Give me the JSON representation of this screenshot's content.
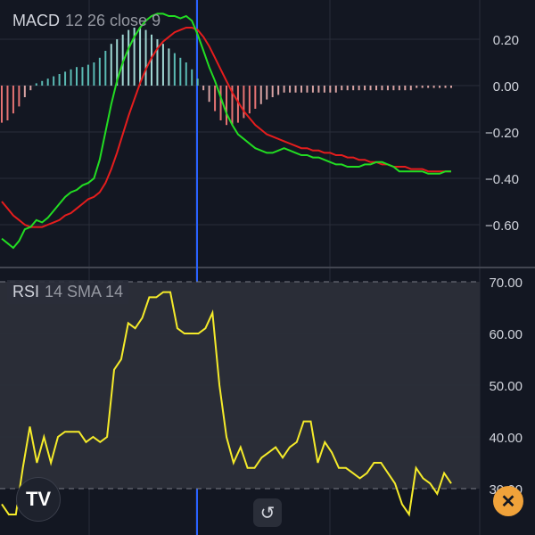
{
  "colors": {
    "background": "#131722",
    "grid": "#2a2e39",
    "macd_line": "#22dd22",
    "signal_line": "#e51d1d",
    "hist_pos": "#5bbab4",
    "hist_pos_strong": "#a0d6d2",
    "hist_neg": "#e57373",
    "hist_neg_weak": "#d8a3a3",
    "rsi_line": "#f5eb2a",
    "rsi_band": "#2a2d37",
    "crosshair": "#2962ff",
    "axis_text": "#d1d4dc"
  },
  "macd_panel": {
    "name": "MACD",
    "params": "12 26 close 9"
  },
  "rsi_panel": {
    "name": "RSI",
    "params": "14 SMA 14"
  },
  "buttons": {
    "logo_text": "TV",
    "logo_icon": "tradingview-logo",
    "reset_symbol": "↺",
    "reset_icon": "reset-chart-icon",
    "close_symbol": "✕",
    "close_icon": "close-icon"
  },
  "chart_data": [
    {
      "type": "line",
      "title": "MACD 12 26 close 9",
      "ylim": [
        -0.78,
        0.34
      ],
      "yticks": [
        "0.20",
        "0.00",
        "−0.20",
        "−0.40",
        "−0.60"
      ],
      "ytick_values": [
        0.2,
        0.0,
        -0.2,
        -0.4,
        -0.6
      ],
      "x": [
        0,
        1,
        2,
        3,
        4,
        5,
        6,
        7,
        8,
        9,
        10,
        11,
        12,
        13,
        14,
        15,
        16,
        17,
        18,
        19,
        20,
        21,
        22,
        23,
        24,
        25,
        26,
        27,
        28,
        29,
        30,
        31,
        32,
        33,
        34,
        35,
        36,
        37,
        38,
        39,
        40,
        41,
        42,
        43,
        44,
        45,
        46,
        47,
        48,
        49,
        50,
        51,
        52,
        53,
        54,
        55,
        56,
        57,
        58,
        59,
        60,
        61,
        62,
        63,
        64,
        65,
        66,
        67,
        68,
        69,
        70,
        71,
        72,
        73,
        74,
        75,
        76,
        77,
        78,
        79,
        80,
        81,
        82,
        83,
        84
      ],
      "series": [
        {
          "name": "MACD",
          "values": [
            -0.66,
            -0.68,
            -0.7,
            -0.67,
            -0.62,
            -0.61,
            -0.58,
            -0.59,
            -0.57,
            -0.54,
            -0.51,
            -0.48,
            -0.46,
            -0.45,
            -0.43,
            -0.42,
            -0.4,
            -0.32,
            -0.2,
            -0.08,
            0.02,
            0.1,
            0.16,
            0.21,
            0.25,
            0.28,
            0.3,
            0.31,
            0.31,
            0.3,
            0.3,
            0.29,
            0.3,
            0.28,
            0.22,
            0.15,
            0.08,
            0.02,
            -0.05,
            -0.12,
            -0.17,
            -0.21,
            -0.23,
            -0.25,
            -0.27,
            -0.28,
            -0.29,
            -0.29,
            -0.28,
            -0.27,
            -0.28,
            -0.29,
            -0.3,
            -0.3,
            -0.31,
            -0.31,
            -0.32,
            -0.33,
            -0.34,
            -0.34,
            -0.35,
            -0.35,
            -0.35,
            -0.34,
            -0.34,
            -0.33,
            -0.33,
            -0.34,
            -0.35,
            -0.37,
            -0.37,
            -0.37,
            -0.37,
            -0.37,
            -0.38,
            -0.38,
            -0.38,
            -0.37,
            -0.37
          ]
        },
        {
          "name": "Signal",
          "values": [
            -0.5,
            -0.53,
            -0.56,
            -0.58,
            -0.6,
            -0.61,
            -0.61,
            -0.61,
            -0.6,
            -0.59,
            -0.58,
            -0.56,
            -0.55,
            -0.53,
            -0.51,
            -0.49,
            -0.48,
            -0.46,
            -0.42,
            -0.36,
            -0.29,
            -0.21,
            -0.13,
            -0.06,
            0.01,
            0.07,
            0.12,
            0.16,
            0.19,
            0.21,
            0.23,
            0.24,
            0.25,
            0.25,
            0.24,
            0.21,
            0.17,
            0.12,
            0.07,
            0.02,
            -0.03,
            -0.07,
            -0.11,
            -0.14,
            -0.17,
            -0.19,
            -0.21,
            -0.22,
            -0.23,
            -0.24,
            -0.25,
            -0.26,
            -0.27,
            -0.27,
            -0.28,
            -0.28,
            -0.29,
            -0.29,
            -0.3,
            -0.3,
            -0.31,
            -0.31,
            -0.32,
            -0.32,
            -0.33,
            -0.33,
            -0.34,
            -0.34,
            -0.35,
            -0.35,
            -0.35,
            -0.36,
            -0.36,
            -0.36,
            -0.37,
            -0.37,
            -0.37,
            -0.37,
            -0.37
          ]
        }
      ],
      "histogram": {
        "name": "Histogram",
        "values": [
          -0.16,
          -0.15,
          -0.12,
          -0.09,
          -0.05,
          -0.02,
          0.01,
          0.02,
          0.03,
          0.04,
          0.05,
          0.06,
          0.07,
          0.08,
          0.08,
          0.09,
          0.1,
          0.12,
          0.15,
          0.18,
          0.2,
          0.22,
          0.24,
          0.25,
          0.25,
          0.24,
          0.22,
          0.2,
          0.18,
          0.16,
          0.14,
          0.12,
          0.1,
          0.07,
          0.03,
          -0.02,
          -0.07,
          -0.11,
          -0.15,
          -0.17,
          -0.17,
          -0.16,
          -0.14,
          -0.12,
          -0.1,
          -0.08,
          -0.06,
          -0.05,
          -0.04,
          -0.03,
          -0.03,
          -0.03,
          -0.03,
          -0.03,
          -0.03,
          -0.03,
          -0.03,
          -0.03,
          -0.03,
          -0.02,
          -0.02,
          -0.02,
          -0.02,
          -0.02,
          -0.02,
          -0.02,
          -0.02,
          -0.02,
          -0.02,
          -0.02,
          -0.02,
          -0.02,
          -0.01,
          -0.01,
          -0.01,
          -0.01,
          -0.01,
          -0.01,
          -0.01
        ]
      }
    },
    {
      "type": "line",
      "title": "RSI 14 SMA 14",
      "ylim": [
        26,
        70
      ],
      "yticks": [
        "70.00",
        "60.00",
        "50.00",
        "40.00",
        "30.00"
      ],
      "ytick_values": [
        70,
        60,
        50,
        40,
        30
      ],
      "band": [
        30,
        70
      ],
      "series": [
        {
          "name": "RSI",
          "values": [
            27,
            25,
            25,
            34,
            42,
            35,
            40,
            35,
            40,
            41,
            41,
            41,
            39,
            40,
            39,
            40,
            53,
            55,
            62,
            61,
            63,
            67,
            67,
            68,
            68,
            61,
            60,
            60,
            60,
            61,
            64,
            50,
            40,
            35,
            38,
            34,
            34,
            36,
            37,
            38,
            36,
            38,
            39,
            43,
            43,
            35,
            39,
            37,
            34,
            34,
            33,
            32,
            33,
            35,
            35,
            33,
            31,
            27,
            25,
            34,
            32,
            31,
            29,
            33,
            31
          ]
        }
      ]
    }
  ]
}
